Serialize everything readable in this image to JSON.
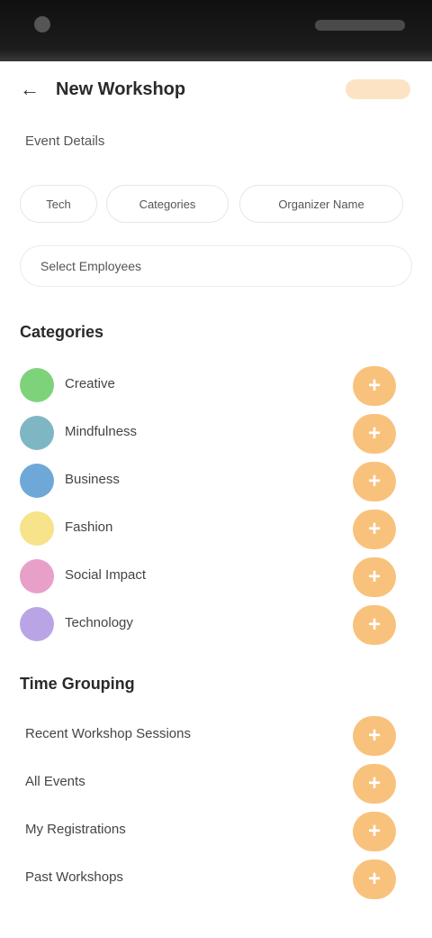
{
  "header": {
    "title": "New Workshop",
    "back_icon": "back-arrow-icon"
  },
  "form": {
    "section_label": "Event Details",
    "filters": [
      "Tech",
      "Categories",
      "Organizer Name"
    ],
    "wide_field": "Select Employees"
  },
  "categories": {
    "title": "Categories",
    "items": [
      {
        "label": "Creative",
        "color": "#7ed37a"
      },
      {
        "label": "Mindfulness",
        "color": "#7fb6c4"
      },
      {
        "label": "Business",
        "color": "#6ea8d8"
      },
      {
        "label": "Fashion",
        "color": "#f6e38a"
      },
      {
        "label": "Social Impact",
        "color": "#e8a0c8"
      },
      {
        "label": "Technology",
        "color": "#b9a5e6"
      }
    ],
    "add_symbol": "+"
  },
  "time_grouping": {
    "title": "Time Grouping",
    "items": [
      {
        "label": "Recent Workshop Sessions"
      },
      {
        "label": "All Events"
      },
      {
        "label": "My Registrations"
      },
      {
        "label": "Past Workshops"
      }
    ],
    "add_symbol": "+"
  },
  "colors": {
    "accent": "#f8c27d",
    "status_bar": "#121212"
  }
}
